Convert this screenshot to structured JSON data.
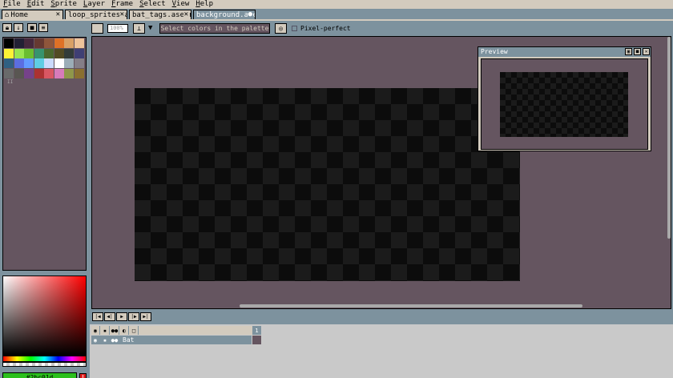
{
  "menu": [
    {
      "label": "File",
      "key": "F"
    },
    {
      "label": "Edit",
      "key": "E"
    },
    {
      "label": "Sprite",
      "key": "S"
    },
    {
      "label": "Layer",
      "key": "L"
    },
    {
      "label": "Frame",
      "key": "F"
    },
    {
      "label": "Select",
      "key": "S"
    },
    {
      "label": "View",
      "key": "V"
    },
    {
      "label": "Help",
      "key": "H"
    }
  ],
  "tabs": [
    {
      "label": "Home",
      "icon": "home-icon",
      "close": "✕",
      "active": false
    },
    {
      "label": "loop_sprites.ase",
      "close": "✕",
      "active": false
    },
    {
      "label": "bat_tags.asepri",
      "close": "✕",
      "active": false
    },
    {
      "label": "background.ase",
      "close": "●",
      "active": true
    }
  ],
  "palette": {
    "colors": [
      "#000000",
      "#222034",
      "#45283c",
      "#663931",
      "#8f563b",
      "#df7126",
      "#d9a066",
      "#eec39a",
      "#fbf236",
      "#99e550",
      "#6abe30",
      "#37946e",
      "#4b692f",
      "#524b24",
      "#323c39",
      "#3f3f74",
      "#306082",
      "#5b6ee1",
      "#639bff",
      "#5fcde4",
      "#cbdbfc",
      "#ffffff",
      "#9badb7",
      "#847e87",
      "#696a6a",
      "#595652",
      "#76428a",
      "#ac3232",
      "#d95763",
      "#d77bba",
      "#8f974a",
      "#8a6f30"
    ],
    "marker": "II"
  },
  "colors": {
    "foreground": "#2bc01d",
    "background": "#000000",
    "warning_symbol": "!"
  },
  "context_bar": {
    "opacity_placeholder": "100%",
    "select_label": "Select colors in the palette",
    "pixel_perfect_label": "Pixel-perfect",
    "pixel_perfect_checked": false
  },
  "preview": {
    "title": "Preview"
  },
  "timeline": {
    "frame_number": "1",
    "layers": [
      {
        "name": "Bat"
      }
    ]
  }
}
